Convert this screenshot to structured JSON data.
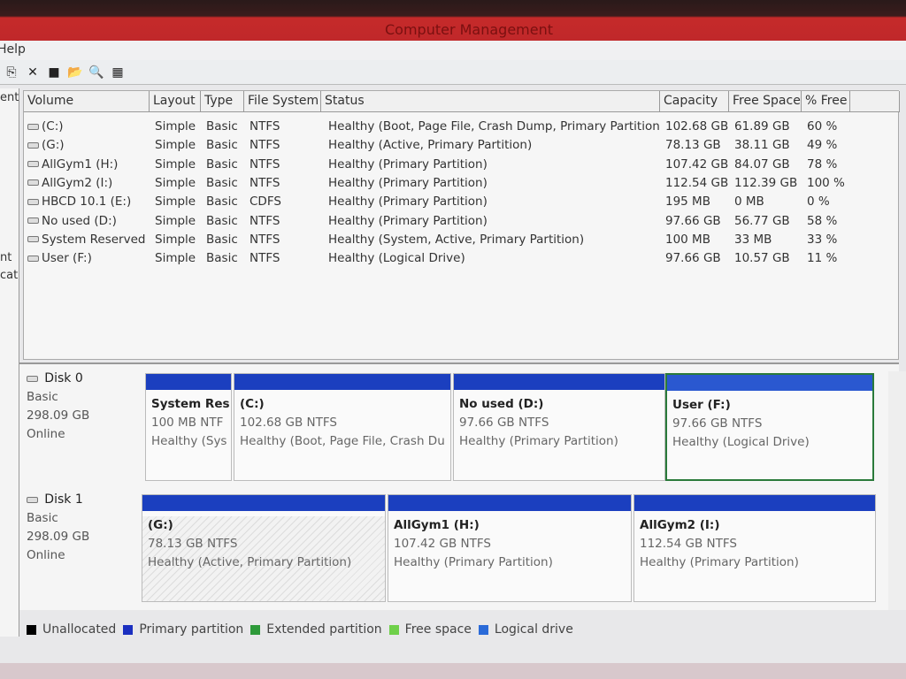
{
  "window": {
    "title": "Computer Management"
  },
  "menu": {
    "help": "Help"
  },
  "left_pane": {
    "fragments": [
      "ent",
      "nt",
      "cati"
    ]
  },
  "table": {
    "columns": [
      "Volume",
      "Layout",
      "Type",
      "File System",
      "Status",
      "Capacity",
      "Free Space",
      "% Free"
    ],
    "rows": [
      {
        "volume": "(C:)",
        "layout": "Simple",
        "type": "Basic",
        "fs": "NTFS",
        "status": "Healthy (Boot, Page File, Crash Dump, Primary Partition)",
        "capacity": "102.68 GB",
        "free": "61.89 GB",
        "pct": "60 %"
      },
      {
        "volume": "(G:)",
        "layout": "Simple",
        "type": "Basic",
        "fs": "NTFS",
        "status": "Healthy (Active, Primary Partition)",
        "capacity": "78.13 GB",
        "free": "38.11 GB",
        "pct": "49 %"
      },
      {
        "volume": "AllGym1 (H:)",
        "layout": "Simple",
        "type": "Basic",
        "fs": "NTFS",
        "status": "Healthy (Primary Partition)",
        "capacity": "107.42 GB",
        "free": "84.07 GB",
        "pct": "78 %"
      },
      {
        "volume": "AllGym2 (I:)",
        "layout": "Simple",
        "type": "Basic",
        "fs": "NTFS",
        "status": "Healthy (Primary Partition)",
        "capacity": "112.54 GB",
        "free": "112.39 GB",
        "pct": "100 %"
      },
      {
        "volume": "HBCD 10.1 (E:)",
        "layout": "Simple",
        "type": "Basic",
        "fs": "CDFS",
        "status": "Healthy (Primary Partition)",
        "capacity": "195 MB",
        "free": "0 MB",
        "pct": "0 %"
      },
      {
        "volume": "No used (D:)",
        "layout": "Simple",
        "type": "Basic",
        "fs": "NTFS",
        "status": "Healthy (Primary Partition)",
        "capacity": "97.66 GB",
        "free": "56.77 GB",
        "pct": "58 %"
      },
      {
        "volume": "System Reserved",
        "layout": "Simple",
        "type": "Basic",
        "fs": "NTFS",
        "status": "Healthy (System, Active, Primary Partition)",
        "capacity": "100 MB",
        "free": "33 MB",
        "pct": "33 %"
      },
      {
        "volume": "User (F:)",
        "layout": "Simple",
        "type": "Basic",
        "fs": "NTFS",
        "status": "Healthy (Logical Drive)",
        "capacity": "97.66 GB",
        "free": "10.57 GB",
        "pct": "11 %"
      }
    ]
  },
  "disks": [
    {
      "name": "Disk 0",
      "type": "Basic",
      "size": "298.09 GB",
      "state": "Online",
      "partitions": [
        {
          "name": "System Res",
          "size": "100 MB NTF",
          "status": "Healthy (Sys"
        },
        {
          "name": "(C:)",
          "size": "102.68 GB NTFS",
          "status": "Healthy (Boot, Page File, Crash Du"
        },
        {
          "name": "No used  (D:)",
          "size": "97.66 GB NTFS",
          "status": "Healthy (Primary Partition)"
        },
        {
          "name": "User  (F:)",
          "size": "97.66 GB NTFS",
          "status": "Healthy (Logical Drive)"
        }
      ]
    },
    {
      "name": "Disk 1",
      "type": "Basic",
      "size": "298.09 GB",
      "state": "Online",
      "partitions": [
        {
          "name": "(G:)",
          "size": "78.13 GB NTFS",
          "status": "Healthy (Active, Primary Partition)"
        },
        {
          "name": "AllGym1  (H:)",
          "size": "107.42 GB NTFS",
          "status": "Healthy (Primary Partition)"
        },
        {
          "name": "AllGym2  (I:)",
          "size": "112.54 GB NTFS",
          "status": "Healthy (Primary Partition)"
        }
      ]
    }
  ],
  "legend": [
    {
      "label": "Unallocated",
      "color": "#000000"
    },
    {
      "label": "Primary partition",
      "color": "#1b2fc0"
    },
    {
      "label": "Extended partition",
      "color": "#2e9a3a"
    },
    {
      "label": "Free space",
      "color": "#6fd04a"
    },
    {
      "label": "Logical drive",
      "color": "#2a6ad8"
    }
  ]
}
